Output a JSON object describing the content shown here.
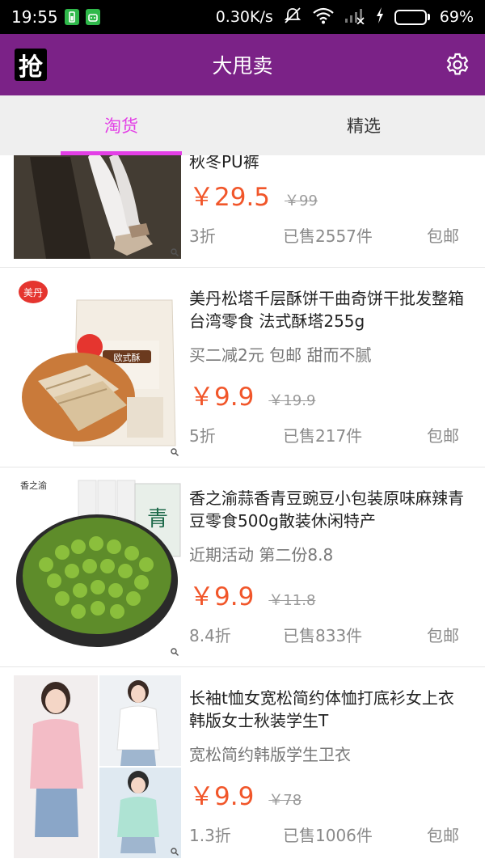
{
  "status_bar": {
    "time": "19:55",
    "network_speed": "0.30K/s",
    "battery_percent": "69%",
    "battery_level": 0.69
  },
  "app_bar": {
    "logo_text": "抢",
    "title": "大甩卖",
    "settings_icon": "gear-icon"
  },
  "tabs": [
    {
      "label": "淘货",
      "active": true
    },
    {
      "label": "精选",
      "active": false
    }
  ],
  "products": [
    {
      "title": "秋冬PU裤",
      "subtitle": "",
      "price": "￥29.5",
      "original_price": "￥99",
      "discount": "3折",
      "sold": "已售2557件",
      "shipping": "包邮"
    },
    {
      "title": "美丹松塔千层酥饼干曲奇饼干批发整箱台湾零食 法式酥塔255g",
      "subtitle": "买二减2元 包邮 甜而不腻",
      "price": "￥9.9",
      "original_price": "￥19.9",
      "discount": "5折",
      "sold": "已售217件",
      "shipping": "包邮",
      "image_text": {
        "badge": "美丹",
        "package": "欧式酥"
      }
    },
    {
      "title": "香之渝蒜香青豆豌豆小包装原味麻辣青豆零食500g散装休闲特产",
      "subtitle": "近期活动 第二份8.8",
      "price": "￥9.9",
      "original_price": "￥11.8",
      "discount": "8.4折",
      "sold": "已售833件",
      "shipping": "包邮",
      "image_text": {
        "brand": "香之渝",
        "package": "青"
      }
    },
    {
      "title": "长袖t恤女宽松简约体恤打底衫女上衣韩版女士秋装学生T",
      "subtitle": "宽松简约韩版学生卫衣",
      "price": "￥9.9",
      "original_price": "￥78",
      "discount": "1.3折",
      "sold": "已售1006件",
      "shipping": "包邮"
    }
  ]
}
